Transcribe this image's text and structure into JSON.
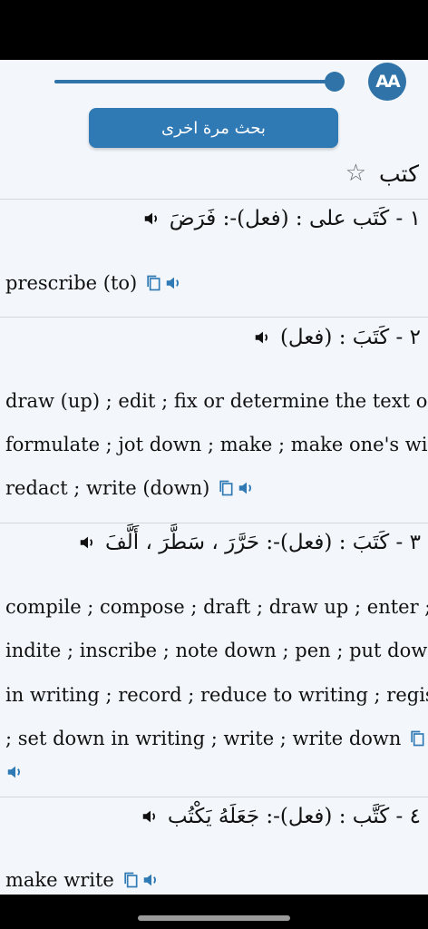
{
  "toolbar": {
    "font_button_label": "AA",
    "slider_value": 0.97
  },
  "search_again_label": "بحث مرة اخرى",
  "headword": "كتب",
  "entries": [
    {
      "arabic": "١ - كَتَب على : (فعل)-: فَرَضَ",
      "english": [
        "prescribe (to)"
      ]
    },
    {
      "arabic": "٢ - كَتَبَ : (فعل)",
      "english": [
        "draw (up) ; edit ; fix or determine the text of ;",
        "formulate ; jot down ; make ; make one's will ;",
        "redact ; write (down)"
      ]
    },
    {
      "arabic": "٣ - كَتَبَ : (فعل)-: حَرَّرَ ، سَطَّرَ ، أَلَّفَ",
      "english": [
        "compile ; compose ; draft ; draw up ; enter ;",
        "indite ; inscribe ; note down ; pen ; put down",
        "in writing ; record ; reduce to writing ; register",
        "; set down in writing ; write ; write down"
      ]
    },
    {
      "arabic": "٤ - كَتَّب : (فعل)-: جَعَلَهُ يَكْتُب",
      "english": [
        "make write"
      ]
    }
  ]
}
